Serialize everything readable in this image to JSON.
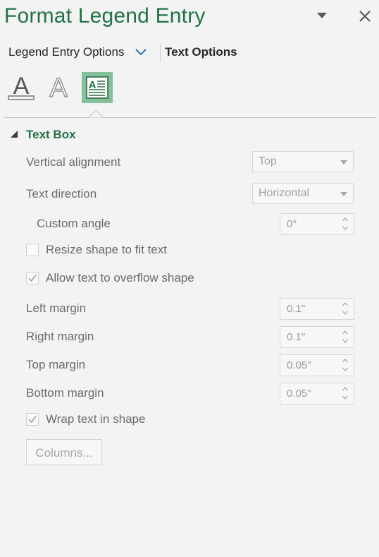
{
  "pane": {
    "title": "Format Legend Entry"
  },
  "tabs": {
    "legend_entry_options": "Legend Entry Options",
    "text_options": "Text Options"
  },
  "icons": {
    "text_fill_letter": "A",
    "text_outline_letter": "A",
    "textbox_letter": "A"
  },
  "section": {
    "title": "Text Box"
  },
  "fields": {
    "vertical_alignment": {
      "label": "Vertical alignment",
      "value": "Top"
    },
    "text_direction": {
      "label": "Text direction",
      "value": "Horizontal"
    },
    "custom_angle": {
      "label": "Custom angle",
      "value": "0°"
    },
    "resize_shape": {
      "label": "Resize shape to fit text",
      "checked": false
    },
    "allow_overflow": {
      "label": "Allow text to overflow shape",
      "checked": true
    },
    "left_margin": {
      "label": "Left margin",
      "value": "0.1\""
    },
    "right_margin": {
      "label": "Right margin",
      "value": "0.1\""
    },
    "top_margin": {
      "label": "Top margin",
      "value": "0.05\""
    },
    "bottom_margin": {
      "label": "Bottom margin",
      "value": "0.05\""
    },
    "wrap_text": {
      "label": "Wrap text in shape",
      "checked": true
    }
  },
  "buttons": {
    "columns": "Columns..."
  },
  "colors": {
    "accent": "#217346",
    "selected_icon_bg": "#86bf9b",
    "pane_bg": "#f3f3f3"
  }
}
